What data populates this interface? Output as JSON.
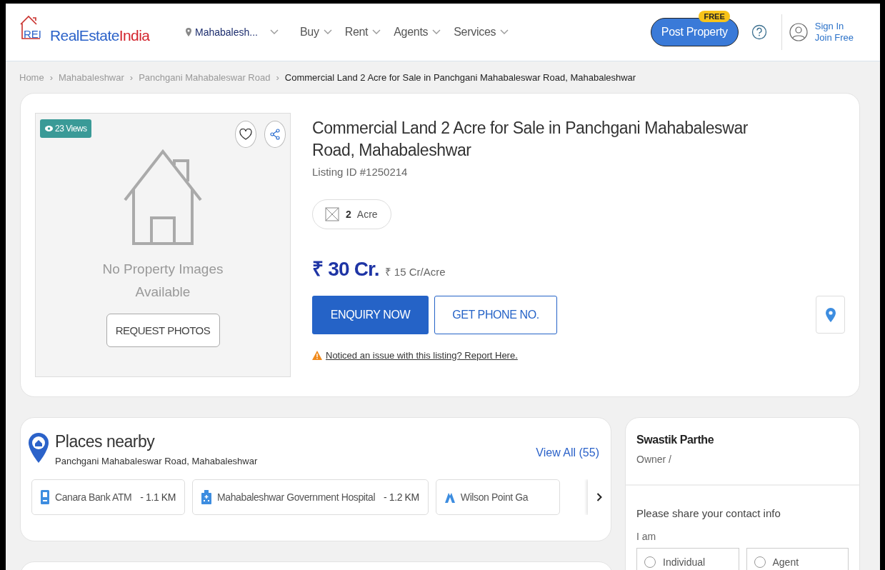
{
  "header": {
    "logo_mark": "REI",
    "logo_text_1": "RealEstate",
    "logo_text_2": "India",
    "location": "Mahabalesh...",
    "nav": [
      {
        "label": "Buy"
      },
      {
        "label": "Rent"
      },
      {
        "label": "Agents"
      },
      {
        "label": "Services"
      }
    ],
    "post_button": "Post Property",
    "post_badge": "FREE",
    "sign_in": "Sign In",
    "join": "Join Free"
  },
  "breadcrumb": [
    {
      "label": "Home",
      "current": false
    },
    {
      "sep": "›",
      "label": "Mahabaleshwar",
      "current": false
    },
    {
      "sep": "›",
      "label": "Panchgani Mahabaleswar Road",
      "current": false
    },
    {
      "sep": "›",
      "label": "Commercial Land 2 Acre for Sale in Panchgani Mahabaleswar Road, Mahabaleshwar",
      "current": true
    }
  ],
  "listing": {
    "views": "23 Views",
    "no_image": "No Property Images Available",
    "request_button": "REQUEST PHOTOS",
    "title": "Commercial Land 2 Acre for Sale in Panchgani Mahabaleswar Road, Mahabaleshwar",
    "listing_id": "Listing ID #1250214",
    "area_value": "2",
    "area_unit": "Acre",
    "price": "₹ 30 Cr.",
    "price_per": "₹ 15 Cr/Acre",
    "enquiry_button": "ENQUIRY NOW",
    "phone_button": "GET PHONE NO.",
    "report_link": "Noticed an issue with this listing? Report Here."
  },
  "places": {
    "title": "Places nearby",
    "subtitle": "Panchgani Mahabaleswar Road, Mahabaleshwar",
    "view_all": "View All (55)",
    "items": [
      {
        "kind": "atm",
        "name": "Canara Bank ATM",
        "distance": "- 1.1 KM"
      },
      {
        "kind": "hospital",
        "name": "Mahabaleshwar Government Hospital",
        "distance": "- 1.2 KM"
      },
      {
        "kind": "landmark",
        "name": "Wilson Point Ga"
      }
    ]
  },
  "contact": {
    "name": "Swastik Parthe",
    "role": "Owner /",
    "prompt": "Please share your contact info",
    "i_am": "I am",
    "options": [
      {
        "label": "Individual",
        "selected": false
      },
      {
        "label": "Agent",
        "selected": false
      }
    ]
  }
}
